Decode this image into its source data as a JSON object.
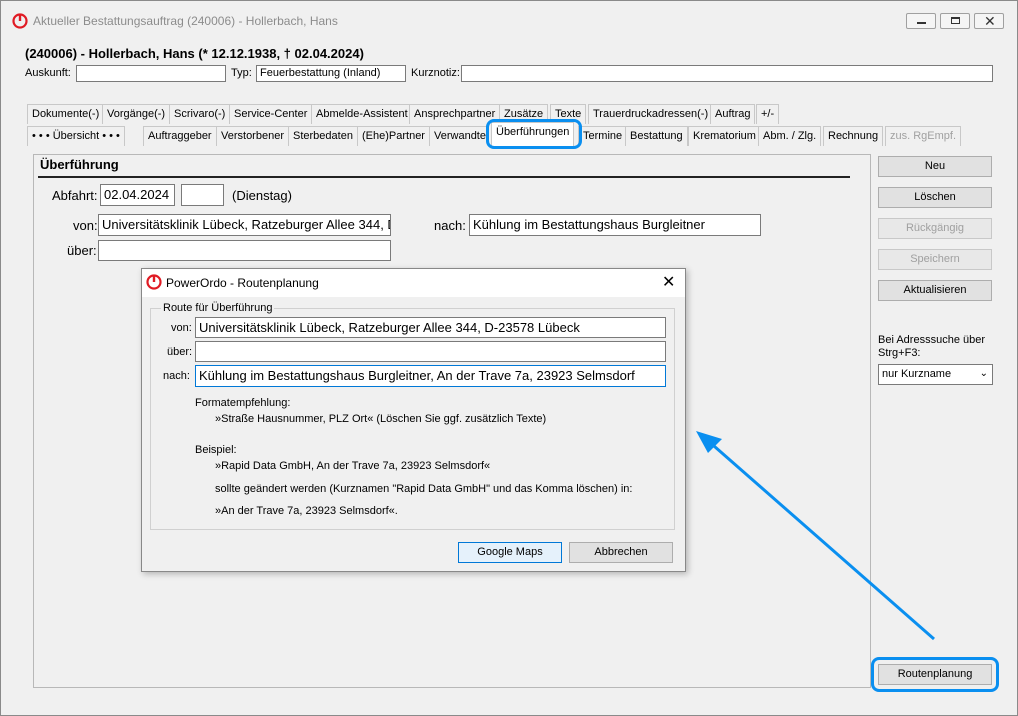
{
  "window": {
    "title": "Aktueller Bestattungsauftrag (240006) - Hollerbach, Hans",
    "controls": [
      "minimize",
      "maximize",
      "close"
    ]
  },
  "header": {
    "name": "(240006) - Hollerbach, Hans (* 12.12.1938, † 02.04.2024)",
    "auskunft_label": "Auskunft:",
    "auskunft_value": "",
    "typ_label": "Typ:",
    "typ_value": "Feuerbestattung (Inland)",
    "kurznotiz_label": "Kurznotiz:",
    "kurznotiz_value": ""
  },
  "tabs_row1": [
    "Dokumente(-)",
    "Vorgänge(-)",
    "Scrivaro(-)",
    "Service-Center",
    "Abmelde-Assistent",
    "Ansprechpartner",
    "Zusätze",
    "Texte",
    "Trauerdruckadressen(-)",
    "Auftrag",
    "+/-"
  ],
  "tabs_row2": [
    "• • •  Übersicht  • • •",
    "Auftraggeber",
    "Verstorbener",
    "Sterbedaten",
    "(Ehe)Partner",
    "Verwandte",
    "Überführungen",
    "Termine",
    "Bestattung",
    "Krematorium",
    "Abm. / Zlg.",
    "Rechnung",
    "zus. RgEmpf."
  ],
  "panel": {
    "heading": "Überführung",
    "abfahrt_label": "Abfahrt:",
    "abfahrt_date": "02.04.2024",
    "abfahrt_time": "",
    "weekday": "(Dienstag)",
    "von_label": "von:",
    "von_value": "Universitätsklinik Lübeck, Ratzeburger Allee 344, D",
    "nach_label": "nach:",
    "nach_value": "Kühlung im Bestattungshaus Burgleitner",
    "ueber_label": "über:",
    "ueber_value": ""
  },
  "side_buttons": {
    "neu": "Neu",
    "loeschen": "Löschen",
    "rueckgaengig": "Rückgängig",
    "speichern": "Speichern",
    "aktualisieren": "Aktualisieren",
    "adress_hint": "Bei Adresssuche über Strg+F3:",
    "adress_select": "nur Kurzname",
    "routenplanung": "Routenplanung"
  },
  "dialog": {
    "title": "PowerOrdo - Routenplanung",
    "group_label": "Route für Überführung",
    "von_label": "von:",
    "von_value": "Universitätsklinik Lübeck, Ratzeburger Allee 344, D-23578 Lübeck",
    "ueber_label": "über:",
    "ueber_value": "",
    "nach_label": "nach:",
    "nach_value": "Kühlung im Bestattungshaus Burgleitner, An der Trave 7a, 23923 Selmsdorf",
    "format_heading": "Formatempfehlung:",
    "format_text": "»Straße Hausnummer, PLZ Ort« (Löschen Sie ggf. zusätzlich Texte)",
    "beispiel_heading": "Beispiel:",
    "beispiel_1": "»Rapid Data GmbH, An der Trave 7a, 23923 Selmsdorf«",
    "beispiel_2": "sollte geändert werden (Kurznamen \"Rapid Data GmbH\" und das Komma löschen) in:",
    "beispiel_3": "»An der Trave 7a, 23923 Selmsdorf«.",
    "google_maps": "Google Maps",
    "abbrechen": "Abbrechen"
  },
  "colors": {
    "highlight": "#0a8ff0",
    "logo": "#e01b24"
  }
}
